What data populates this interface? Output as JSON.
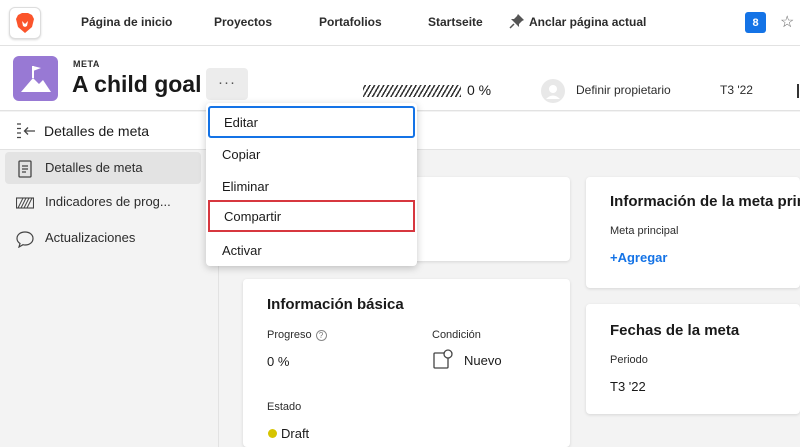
{
  "nav": {
    "brand_icon": "brave-lion-icon",
    "links": [
      "Página de inicio",
      "Proyectos",
      "Portafolios",
      "Startseite"
    ],
    "pin_label": "Anclar página actual",
    "notification_count": "8"
  },
  "header": {
    "type_label": "META",
    "title": "A child goal",
    "more_label": "···",
    "progress": "0 %",
    "owner": "Definir propietario",
    "period": "T3 '22"
  },
  "sidebar": {
    "header_label": "Detalles de meta",
    "items": [
      {
        "label": "Detalles de meta",
        "icon": "document-icon",
        "active": true
      },
      {
        "label": "Indicadores de prog...",
        "icon": "progress-indicator-icon",
        "active": false
      },
      {
        "label": "Actualizaciones",
        "icon": "comment-icon",
        "active": false
      }
    ]
  },
  "menu": {
    "items": [
      "Editar",
      "Copiar",
      "Eliminar",
      "Compartir",
      "Activar"
    ]
  },
  "basic_info": {
    "title": "Información básica",
    "progress_label": "Progreso",
    "progress_value": "0 %",
    "condition_label": "Condición",
    "condition_value": "Nuevo",
    "state_label": "Estado",
    "state_value": "Draft"
  },
  "parent_info": {
    "title": "Información de la meta princ",
    "field_label": "Meta principal",
    "add_label": "+Agregar"
  },
  "dates": {
    "title": "Fechas de la meta",
    "field_label": "Periodo",
    "value": "T3 '22"
  },
  "colors": {
    "accent": "#1473e6",
    "goal_icon": "#9879d4",
    "highlight": "#d7373f",
    "status_draft": "#d6c400"
  }
}
